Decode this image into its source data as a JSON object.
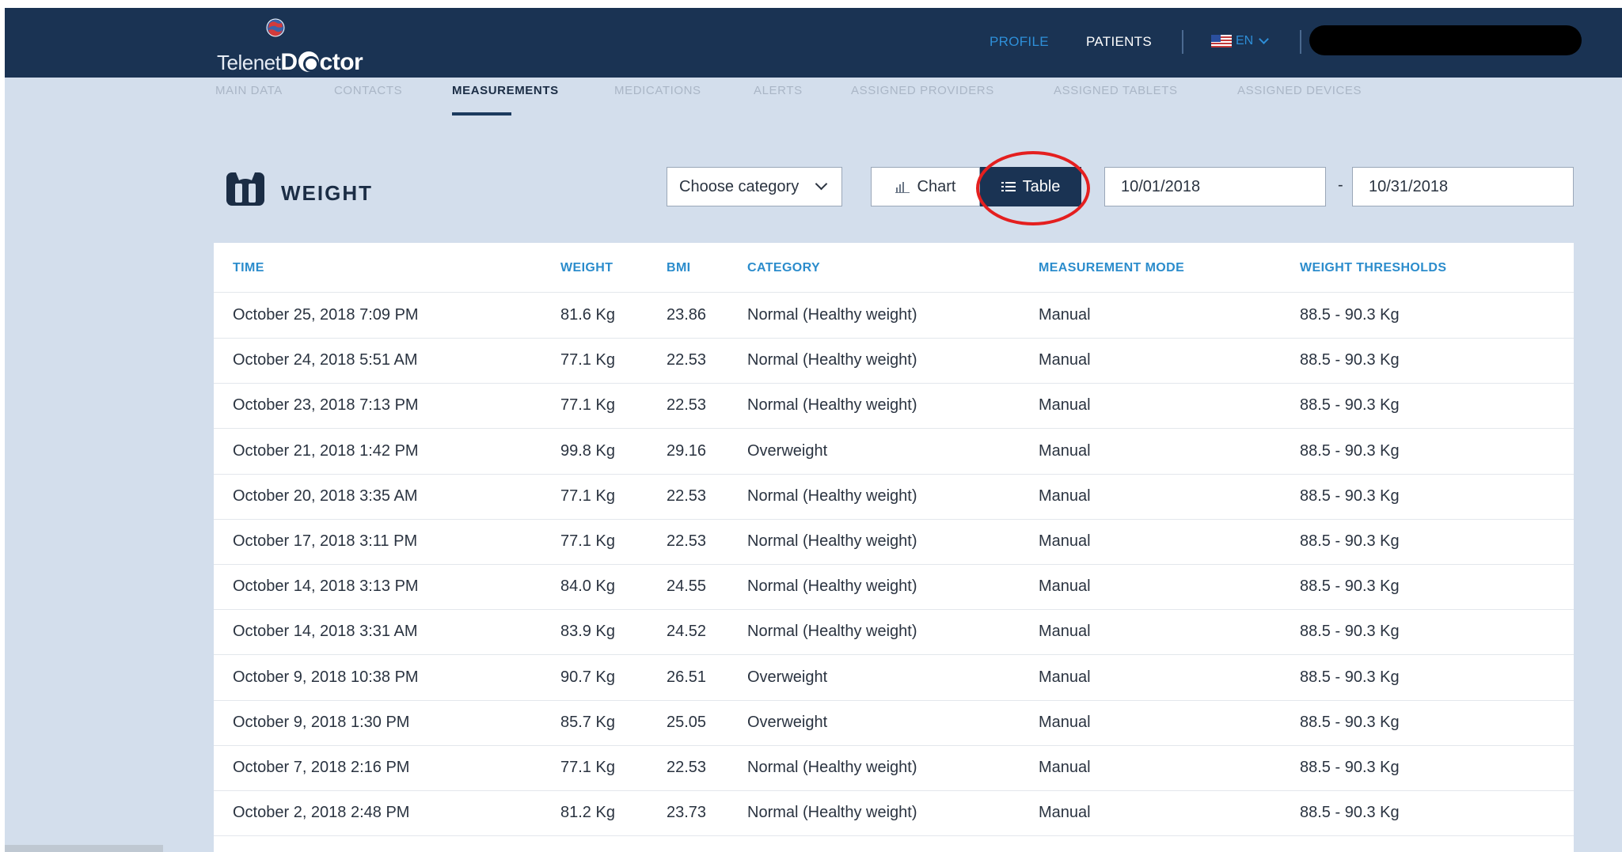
{
  "brand": {
    "logo_text_prefix": "Telenet",
    "logo_text_d": "D",
    "logo_text_suffix": "ctor"
  },
  "header": {
    "profile_label": "PROFILE",
    "patients_label": "PATIENTS",
    "language_label": "EN"
  },
  "tabs": [
    {
      "label": "MAIN DATA",
      "active": false
    },
    {
      "label": "CONTACTS",
      "active": false
    },
    {
      "label": "MEASUREMENTS",
      "active": true
    },
    {
      "label": "MEDICATIONS",
      "active": false
    },
    {
      "label": "ALERTS",
      "active": false
    },
    {
      "label": "ASSIGNED PROVIDERS",
      "active": false
    },
    {
      "label": "ASSIGNED TABLETS",
      "active": false
    },
    {
      "label": "ASSIGNED DEVICES",
      "active": false
    }
  ],
  "section": {
    "title": "WEIGHT"
  },
  "controls": {
    "category_placeholder": "Choose category",
    "chart_label": "Chart",
    "table_label": "Table",
    "date_from": "10/01/2018",
    "date_separator": "-",
    "date_to": "10/31/2018"
  },
  "table": {
    "columns": [
      "TIME",
      "WEIGHT",
      "BMI",
      "CATEGORY",
      "MEASUREMENT MODE",
      "WEIGHT THRESHOLDS"
    ],
    "rows": [
      [
        "October 25, 2018 7:09 PM",
        "81.6 Kg",
        "23.86",
        "Normal (Healthy weight)",
        "Manual",
        "88.5 - 90.3 Kg"
      ],
      [
        "October 24, 2018 5:51 AM",
        "77.1 Kg",
        "22.53",
        "Normal (Healthy weight)",
        "Manual",
        "88.5 - 90.3 Kg"
      ],
      [
        "October 23, 2018 7:13 PM",
        "77.1 Kg",
        "22.53",
        "Normal (Healthy weight)",
        "Manual",
        "88.5 - 90.3 Kg"
      ],
      [
        "October 21, 2018 1:42 PM",
        "99.8 Kg",
        "29.16",
        "Overweight",
        "Manual",
        "88.5 - 90.3 Kg"
      ],
      [
        "October 20, 2018 3:35 AM",
        "77.1 Kg",
        "22.53",
        "Normal (Healthy weight)",
        "Manual",
        "88.5 - 90.3 Kg"
      ],
      [
        "October 17, 2018 3:11 PM",
        "77.1 Kg",
        "22.53",
        "Normal (Healthy weight)",
        "Manual",
        "88.5 - 90.3 Kg"
      ],
      [
        "October 14, 2018 3:13 PM",
        "84.0 Kg",
        "24.55",
        "Normal (Healthy weight)",
        "Manual",
        "88.5 - 90.3 Kg"
      ],
      [
        "October 14, 2018 3:31 AM",
        "83.9 Kg",
        "24.52",
        "Normal (Healthy weight)",
        "Manual",
        "88.5 - 90.3 Kg"
      ],
      [
        "October 9, 2018 10:38 PM",
        "90.7 Kg",
        "26.51",
        "Overweight",
        "Manual",
        "88.5 - 90.3 Kg"
      ],
      [
        "October 9, 2018 1:30 PM",
        "85.7 Kg",
        "25.05",
        "Overweight",
        "Manual",
        "88.5 - 90.3 Kg"
      ],
      [
        "October 7, 2018 2:16 PM",
        "77.1 Kg",
        "22.53",
        "Normal (Healthy weight)",
        "Manual",
        "88.5 - 90.3 Kg"
      ],
      [
        "October 2, 2018 2:48 PM",
        "81.2 Kg",
        "23.73",
        "Normal (Healthy weight)",
        "Manual",
        "88.5 - 90.3 Kg"
      ]
    ]
  },
  "colors": {
    "header_bg": "#1a3353",
    "page_bg": "#d3deec",
    "accent_blue": "#2e8fd8",
    "column_header": "#2b8ccc",
    "highlight_ring": "#e41f1f"
  }
}
